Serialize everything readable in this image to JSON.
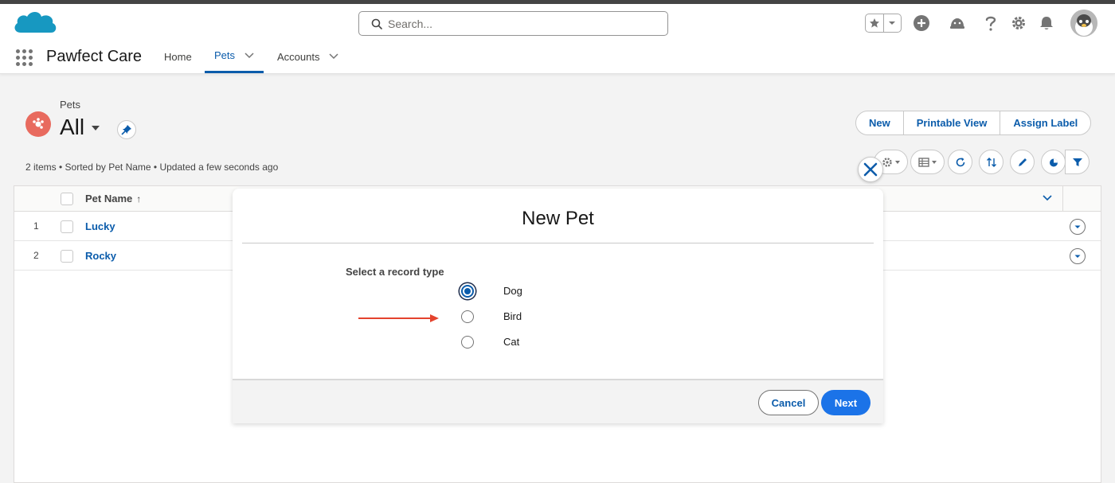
{
  "header": {
    "search_placeholder": "Search...",
    "icons": [
      "salesforce-cloud-logo",
      "star-icon",
      "chevron-down-icon",
      "add-icon",
      "trailhead-icon",
      "help-icon",
      "setup-gear-icon",
      "bell-icon",
      "avatar"
    ]
  },
  "nav": {
    "app_name": "Pawfect Care",
    "items": [
      {
        "label": "Home",
        "active": false
      },
      {
        "label": "Pets",
        "active": true
      },
      {
        "label": "Accounts",
        "active": false
      }
    ]
  },
  "list_view": {
    "object_label": "Pets",
    "list_name": "All",
    "info": "2 items • Sorted by Pet Name • Updated a few seconds ago",
    "actions": [
      "New",
      "Printable View",
      "Assign Label"
    ],
    "tools": [
      "settings-gear-icon",
      "table-display-icon",
      "refresh-icon",
      "sort-icon",
      "edit-pencil-icon",
      "chart-icon",
      "filter-icon"
    ]
  },
  "table": {
    "columns": [
      {
        "label": "Pet Name",
        "sort": "↑"
      }
    ],
    "rows": [
      {
        "num": "1",
        "name": "Lucky"
      },
      {
        "num": "2",
        "name": "Rocky"
      }
    ]
  },
  "modal": {
    "title": "New Pet",
    "legend": "Select a record type",
    "options": [
      {
        "label": "Dog",
        "checked": true
      },
      {
        "label": "Bird",
        "checked": false
      },
      {
        "label": "Cat",
        "checked": false
      }
    ],
    "cancel_label": "Cancel",
    "next_label": "Next"
  },
  "colors": {
    "brand_blue": "#0b5cab",
    "next_button": "#1b73e8",
    "salesforce_cloud": "#1798c1",
    "pets_icon": "#e86a5e",
    "annotation_arrow": "#e4432d"
  }
}
